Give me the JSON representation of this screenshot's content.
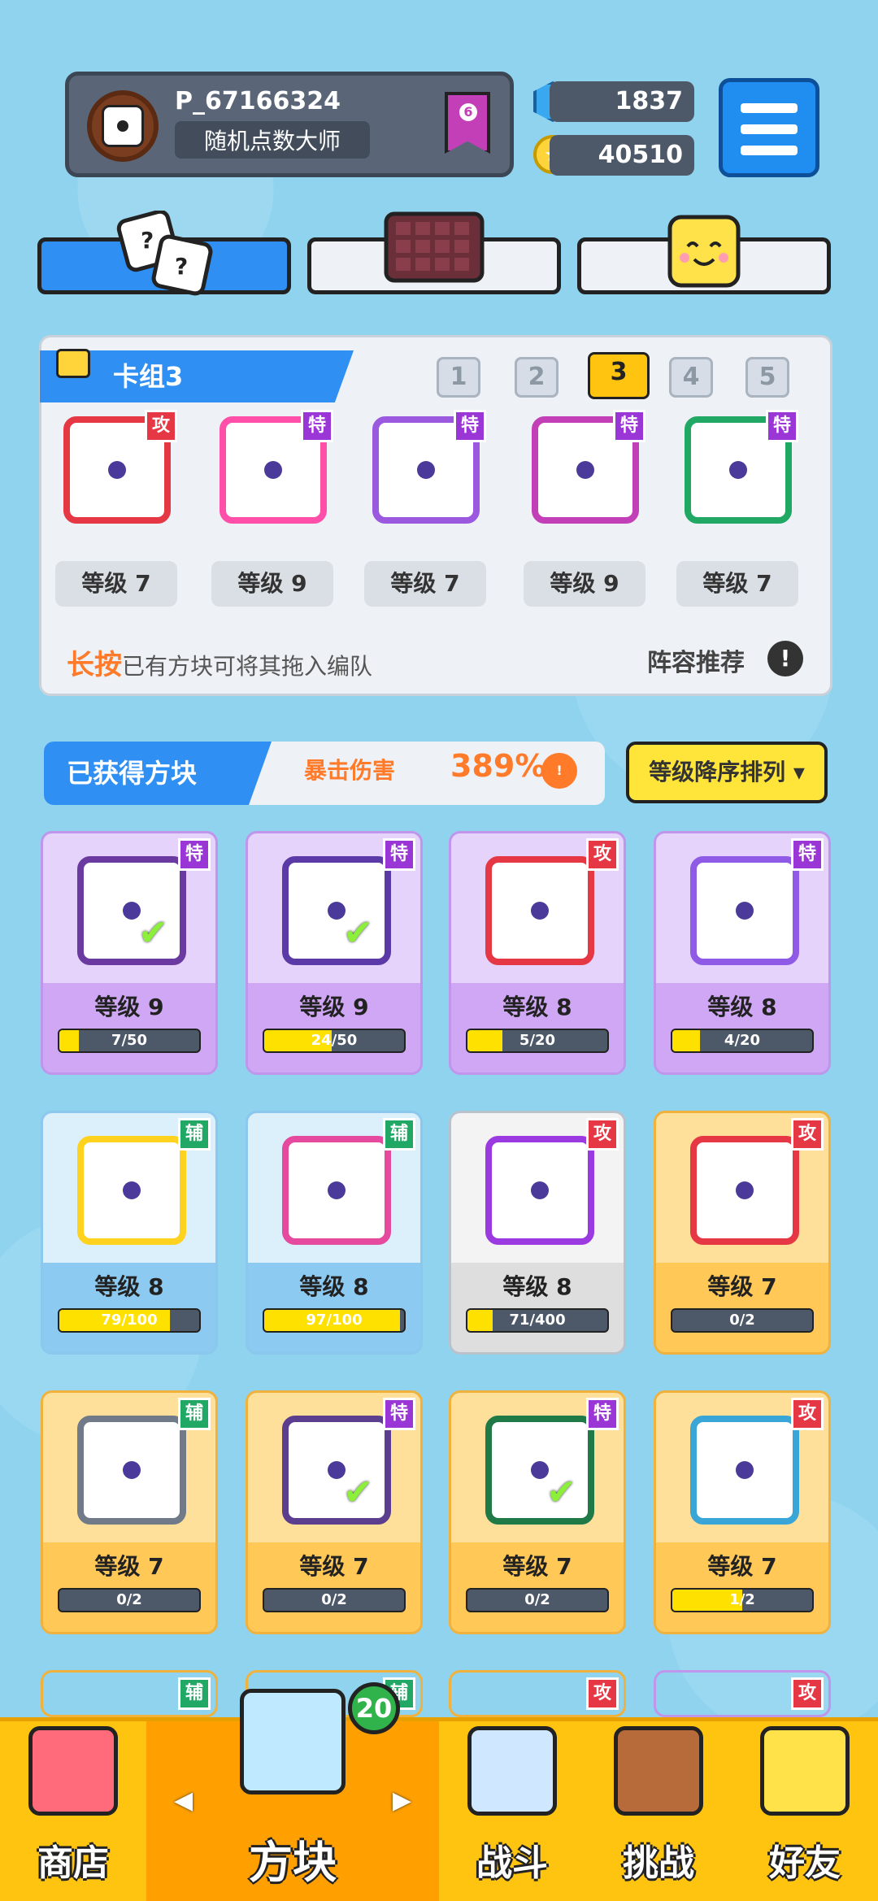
{
  "player": {
    "id": "P_67166324",
    "title": "随机点数大师",
    "rank": "6"
  },
  "currency": {
    "gems": "1837",
    "coins": "40510"
  },
  "deck": {
    "name": "卡组3",
    "slots": [
      "1",
      "2",
      "3",
      "4",
      "5"
    ],
    "selected_slot": "3",
    "cards": [
      {
        "badge": "攻",
        "level": "等级 7",
        "color": "#e63744"
      },
      {
        "badge": "特",
        "level": "等级 9",
        "color": "#ff4fa8"
      },
      {
        "badge": "特",
        "level": "等级 7",
        "color": "#9b59e0"
      },
      {
        "badge": "特",
        "level": "等级 9",
        "color": "#c23fb8"
      },
      {
        "badge": "特",
        "level": "等级 7",
        "color": "#20a864"
      }
    ],
    "hint_bold": "长按",
    "hint_rest": "已有方块可将其拖入编队",
    "recommend": "阵容推荐"
  },
  "owned": {
    "title": "已获得方块",
    "crit_label": "暴击伤害",
    "crit_value": "389%",
    "sort_label": "等级降序排列 ▾"
  },
  "cards": [
    {
      "badge": "特",
      "level": "等级 9",
      "progress": "7/50",
      "fill": 0.14,
      "theme": "purple",
      "equipped": true,
      "color": "#6b3aa0"
    },
    {
      "badge": "特",
      "level": "等级 9",
      "progress": "24/50",
      "fill": 0.48,
      "theme": "purple",
      "equipped": true,
      "color": "#5b3aa8"
    },
    {
      "badge": "攻",
      "level": "等级 8",
      "progress": "5/20",
      "fill": 0.25,
      "theme": "purple",
      "equipped": false,
      "color": "#e63744"
    },
    {
      "badge": "特",
      "level": "等级 8",
      "progress": "4/20",
      "fill": 0.2,
      "theme": "purple",
      "equipped": false,
      "color": "#8e5ae6"
    },
    {
      "badge": "辅",
      "level": "等级 8",
      "progress": "79/100",
      "fill": 0.79,
      "theme": "blue",
      "equipped": false,
      "color": "#ffd21f"
    },
    {
      "badge": "辅",
      "level": "等级 8",
      "progress": "97/100",
      "fill": 0.97,
      "theme": "blue",
      "equipped": false,
      "color": "#e54a9e"
    },
    {
      "badge": "攻",
      "level": "等级 8",
      "progress": "71/400",
      "fill": 0.18,
      "theme": "white",
      "equipped": false,
      "color": "#9b3ae0"
    },
    {
      "badge": "攻",
      "level": "等级 7",
      "progress": "0/2",
      "fill": 0,
      "theme": "orange",
      "equipped": false,
      "color": "#e63744"
    },
    {
      "badge": "辅",
      "level": "等级 7",
      "progress": "0/2",
      "fill": 0,
      "theme": "orange",
      "equipped": false,
      "color": "#707a88"
    },
    {
      "badge": "特",
      "level": "等级 7",
      "progress": "0/2",
      "fill": 0,
      "theme": "orange",
      "equipped": true,
      "color": "#5c3e8e"
    },
    {
      "badge": "特",
      "level": "等级 7",
      "progress": "0/2",
      "fill": 0,
      "theme": "orange",
      "equipped": true,
      "color": "#1f7a47"
    },
    {
      "badge": "攻",
      "level": "等级 7",
      "progress": "1/2",
      "fill": 0.5,
      "theme": "orange",
      "equipped": false,
      "color": "#3aa6d8"
    }
  ],
  "partial_badges": [
    "辅",
    "辅",
    "攻",
    "攻"
  ],
  "nav": {
    "shop": "商店",
    "blocks": "方块",
    "battle": "战斗",
    "challenge": "挑战",
    "friends": "好友",
    "blocks_count": "20"
  }
}
